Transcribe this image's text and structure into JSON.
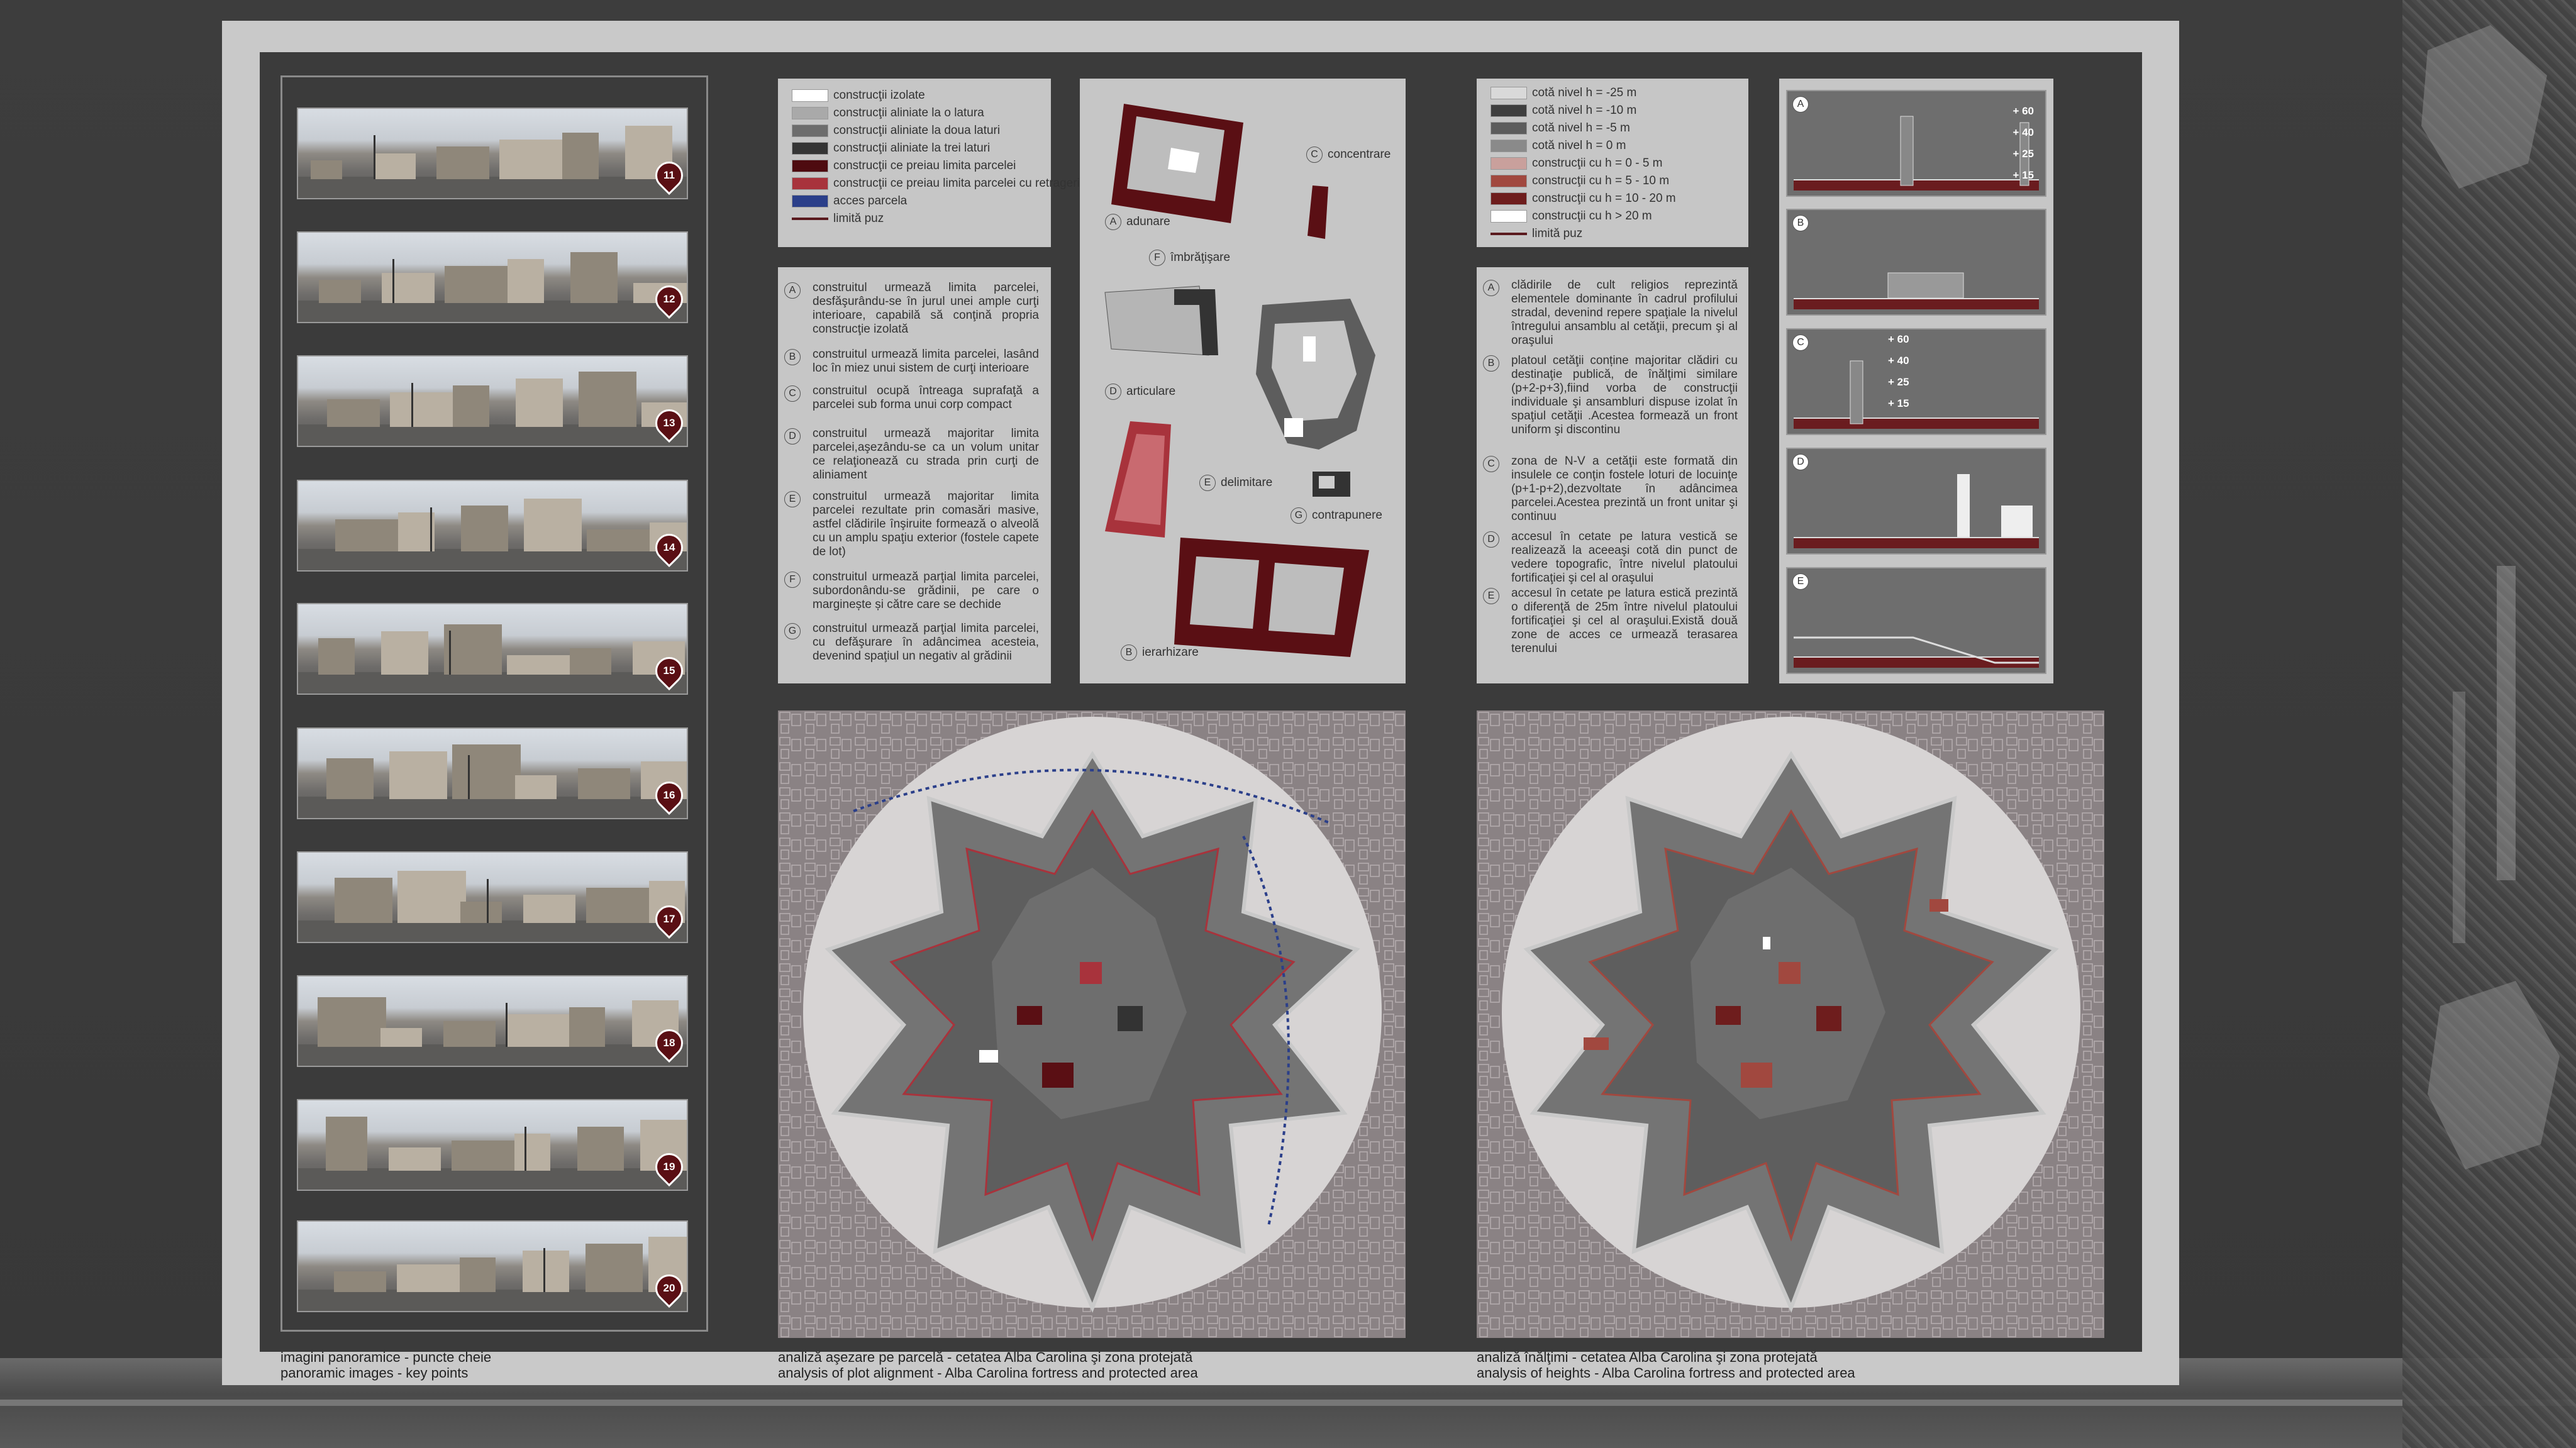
{
  "panoramas": {
    "numbers": [
      "11",
      "12",
      "13",
      "14",
      "15",
      "16",
      "17",
      "18",
      "19",
      "20"
    ],
    "caption_ro": "imagini panoramice - puncte cheie",
    "caption_en": "panoramic images - key points"
  },
  "plot_legend": {
    "items": [
      {
        "label": "construcţii izolate",
        "color": "#ffffff"
      },
      {
        "label": "construcţii aliniate la o latura",
        "color": "#a9a9a9"
      },
      {
        "label": "construcţii aliniate la doua laturi",
        "color": "#6d6d6d"
      },
      {
        "label": "construcţii aliniate la trei laturi",
        "color": "#353535"
      },
      {
        "label": "construcţii ce preiau limita parcelei",
        "color": "#4e0b10"
      },
      {
        "label": "construcţii ce preiau limita parcelei cu retrageri punctuale",
        "color": "#a8333c"
      },
      {
        "label": "acces parcela",
        "color": "#2b3f8a"
      },
      {
        "label": "limită puz",
        "color": "#5a1a1e"
      }
    ]
  },
  "plot_text": {
    "items": [
      {
        "letter": "A",
        "text": "construitul urmează limita parcelei, desfăşurându-se în jurul unei ample curţi interioare, capabilă să conţină propria construcţie izolată"
      },
      {
        "letter": "B",
        "text": "construitul urmează limita parcelei, lasând loc în miez unui sistem de curţi interioare"
      },
      {
        "letter": "C",
        "text": "construitul ocupă întreaga suprafaţă a parcelei sub forma unui corp compact"
      },
      {
        "letter": "D",
        "text": "construitul urmează majoritar limita parcelei,aşezându-se ca un volum unitar ce relaţionează cu strada prin curţi de aliniament"
      },
      {
        "letter": "E",
        "text": "construitul urmează majoritar limita parcelei rezultate prin comasări masive, astfel clădirile înşiruite formează o alveolă cu un amplu spaţiu exterior (fostele capete de lot)"
      },
      {
        "letter": "F",
        "text": "construitul urmează parţial limita parcelei, subordonându-se grădinii, pe care o marginește și către care se dechide"
      },
      {
        "letter": "G",
        "text": "construitul urmează parţial limita parcelei, cu defăşurare în adâncimea acesteia, devenind spaţiul un negativ al grădinii"
      }
    ]
  },
  "typology": {
    "labels": [
      {
        "letter": "C",
        "text": "concentrare"
      },
      {
        "letter": "A",
        "text": "adunare"
      },
      {
        "letter": "F",
        "text": "îmbrăţişare"
      },
      {
        "letter": "D",
        "text": "articulare"
      },
      {
        "letter": "E",
        "text": "delimitare"
      },
      {
        "letter": "G",
        "text": "contrapunere"
      },
      {
        "letter": "B",
        "text": "ierarhizare"
      }
    ]
  },
  "height_legend": {
    "items": [
      {
        "label": "cotă nivel h = -25 m",
        "color": "#d9d9d9"
      },
      {
        "label": "cotă nivel h = -10 m",
        "color": "#3e3e3e"
      },
      {
        "label": "cotă nivel h = -5 m",
        "color": "#5c5c5c"
      },
      {
        "label": "cotă nivel h = 0 m",
        "color": "#8a8a8a"
      },
      {
        "label": "construcţii cu h = 0 - 5 m",
        "color": "#c9a09c"
      },
      {
        "label": "construcţii cu h = 5 - 10 m",
        "color": "#a1483f"
      },
      {
        "label": "construcţii cu h = 10 - 20 m",
        "color": "#6e1d1d"
      },
      {
        "label": "construcţii cu h > 20 m",
        "color": "#ffffff"
      },
      {
        "label": "limită puz",
        "color": "#5a1a1e"
      }
    ]
  },
  "height_text": {
    "items": [
      {
        "letter": "A",
        "text": "clădirile de cult religios reprezintă elementele dominante în cadrul profilului stradal, devenind repere spaţiale la nivelul întregului ansamblu al cetăţii, precum şi al oraşului"
      },
      {
        "letter": "B",
        "text": "platoul cetăţii conține majoritar clădiri cu destinaţie publică, de înălţimi similare (p+2-p+3),fiind vorba de construcţii individuale şi ansambluri dispuse izolat în spaţiul cetăţii .Acestea formează un front uniform şi discontinu"
      },
      {
        "letter": "C",
        "text": "zona de N-V a cetăţii este formată din insulele ce conţin fostele loturi de locuinţe (p+1-p+2),dezvoltate în adâncimea parcelei.Acestea prezintă un front unitar şi continuu"
      },
      {
        "letter": "D",
        "text": "accesul în cetate pe latura vestică se realizează la aceeaşi cotă din punct de vedere topografic, între nivelul platoului fortificaţiei şi cel al oraşului"
      },
      {
        "letter": "E",
        "text": "accesul în cetate pe latura estică prezintă o diferenţă de 25m între nivelul platoului fortificaţiei şi cel al oraşului.Există două zone de acces ce urmează terasarea terenului"
      }
    ]
  },
  "sections": {
    "letters": [
      "A",
      "B",
      "C",
      "D",
      "E"
    ],
    "levels_a": [
      "+ 60",
      "+ 40",
      "+ 25",
      "+ 15"
    ],
    "levels_c": [
      "+ 60",
      "+ 40",
      "+ 25",
      "+ 15"
    ]
  },
  "map_plot": {
    "caption_ro": "analiză aşezare pe parcelă - cetatea Alba Carolina şi zona protejată",
    "caption_en": "analysis of plot alignment - Alba Carolina fortress and protected area"
  },
  "map_height": {
    "caption_ro": "analiză înălţimi - cetatea Alba Carolina şi zona protejată",
    "caption_en": "analysis of heights - Alba Carolina fortress and protected area"
  },
  "colors": {
    "accent_dark_red": "#5a0f14",
    "accent_red": "#a8333c",
    "board": "#c9c9c9",
    "inner": "#3b3b3b"
  }
}
